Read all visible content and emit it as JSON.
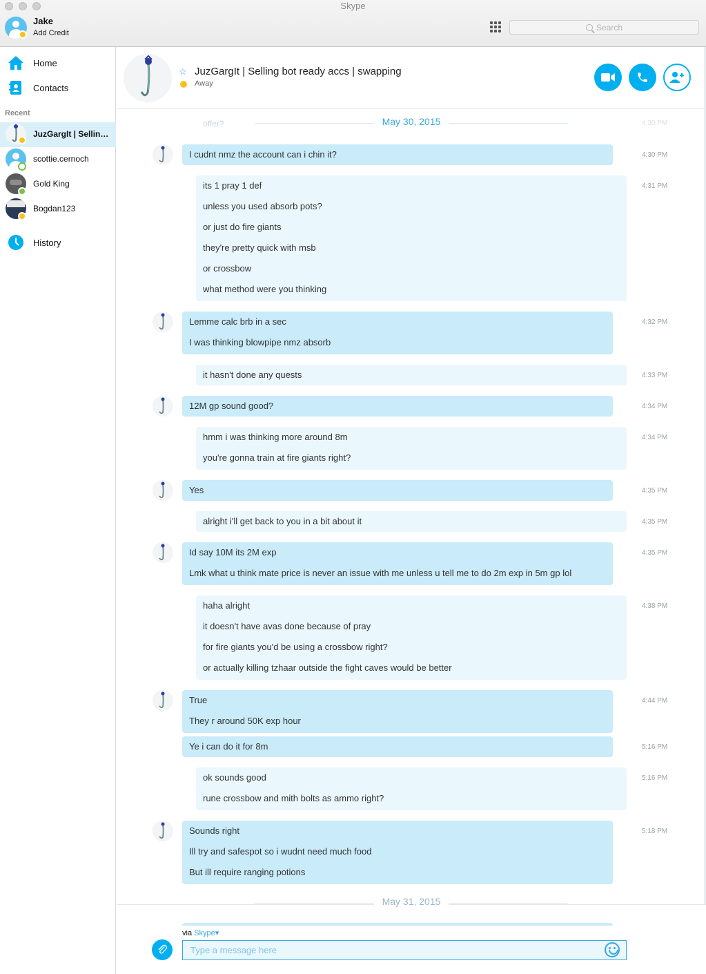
{
  "window": {
    "title": "Skype"
  },
  "me": {
    "name": "Jake",
    "credit": "Add Credit"
  },
  "search": {
    "placeholder": "Search"
  },
  "sidebar": {
    "home": "Home",
    "contacts": "Contacts",
    "recent_label": "Recent",
    "recent": [
      {
        "name": "JuzGargIt | Selling bot ready accs | swapping",
        "status": "away"
      },
      {
        "name": "scottie.cernoch",
        "status": "offline"
      },
      {
        "name": "Gold King",
        "status": "online"
      },
      {
        "name": "Bogdan123",
        "status": "away"
      }
    ],
    "history": "History"
  },
  "conversation": {
    "title": "JuzGargIt | Selling bot ready accs | swapping",
    "status": "Away"
  },
  "messages": {
    "date1": "May 30, 2015",
    "ghost_text": "offer?",
    "ghost_time": "4:30 PM",
    "groups": [
      {
        "from": "them",
        "time": "4:30 PM",
        "lines": [
          "I cudnt nmz the account can i chin it?"
        ]
      },
      {
        "from": "me",
        "time": "4:31 PM",
        "lines": [
          "its 1 pray 1 def",
          "unless you used absorb pots?",
          "or just do fire giants",
          "they're pretty quick with msb",
          "or crossbow",
          "what method were you thinking"
        ]
      },
      {
        "from": "them",
        "time": "4:32 PM",
        "lines": [
          "Lemme calc brb in a sec",
          "I was thinking blowpipe nmz absorb"
        ]
      },
      {
        "from": "me",
        "time": "4:33 PM",
        "lines": [
          "it hasn't done any quests"
        ]
      },
      {
        "from": "them",
        "time": "4:34 PM",
        "lines": [
          "12M gp sound good?"
        ]
      },
      {
        "from": "me",
        "time": "4:34 PM",
        "lines": [
          "hmm i was thinking more around 8m",
          "you're gonna train at fire giants right?"
        ]
      },
      {
        "from": "them",
        "time": "4:35 PM",
        "lines": [
          "Yes"
        ]
      },
      {
        "from": "me",
        "time": "4:35 PM",
        "lines": [
          "alright i'll get back to you in a bit about it"
        ]
      },
      {
        "from": "them",
        "time": "4:35 PM",
        "lines": [
          "Id say 10M its 2M exp",
          "Lmk what u think mate price is never an issue with me unless u tell me to do 2m exp in 5m gp lol"
        ]
      },
      {
        "from": "me",
        "time": "4:38 PM",
        "lines": [
          "haha alright",
          "it doesn't have avas done because of pray",
          "for fire giants you'd be using a crossbow right?",
          "or actually killing tzhaar outside the fight caves would be better"
        ]
      },
      {
        "from": "them",
        "time": "4:44 PM",
        "lines": [
          "True",
          "They r around 50K exp hour"
        ]
      },
      {
        "from": "them",
        "time": "5:16 PM",
        "lines": [
          "Ye i can do it for 8m"
        ]
      },
      {
        "from": "me",
        "time": "5:16 PM",
        "lines": [
          "ok sounds good",
          "rune crossbow and mith bolts as ammo right?"
        ]
      },
      {
        "from": "them",
        "time": "5:18 PM",
        "lines": [
          "Sounds right",
          "Ill try and safespot so i wudnt need much food",
          "But ill require ranging potions"
        ]
      }
    ],
    "date2": "May 31, 2015"
  },
  "compose": {
    "via_prefix": "via",
    "via_service": "Skype",
    "placeholder": "Type a message here"
  },
  "colors": {
    "accent": "#00aff0",
    "incoming_bubble": "#c9ebfa",
    "outgoing_bubble": "#eaf7fd",
    "away": "#f8c21c",
    "online": "#7ac143"
  },
  "icons": {
    "home": "home-icon",
    "contacts": "contacts-icon",
    "history": "history-clock-icon",
    "video": "video-call-icon",
    "call": "phone-call-icon",
    "add": "add-people-icon",
    "dialpad": "dialpad-icon",
    "attach": "paperclip-icon",
    "emoji": "smiley-icon"
  }
}
